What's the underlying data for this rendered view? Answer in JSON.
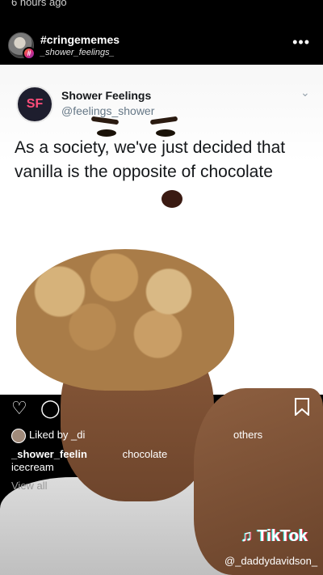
{
  "status": {
    "time_ago": "6 hours ago"
  },
  "header": {
    "account_name": "#cringememes",
    "account_sub": "_shower_feelings_",
    "more_icon": "more-horizontal-icon"
  },
  "tweet": {
    "display_name": "Shower Feelings",
    "handle": "@feelings_shower",
    "text": "As a society, we've just decided that vanilla is the opposite of chocolate",
    "avatar_glyph": "SF"
  },
  "actions": {
    "liked_by": "Liked by _di",
    "liked_others": "others",
    "caption_user": "_shower_feelin",
    "caption_text": "chocolate",
    "caption_end": "icecream",
    "view_all": "View all"
  },
  "watermark": {
    "brand": "TikTok",
    "user": "@_daddydavidson_"
  },
  "colors": {
    "background": "#000000",
    "card": "#ffffff",
    "handle": "#657786"
  }
}
